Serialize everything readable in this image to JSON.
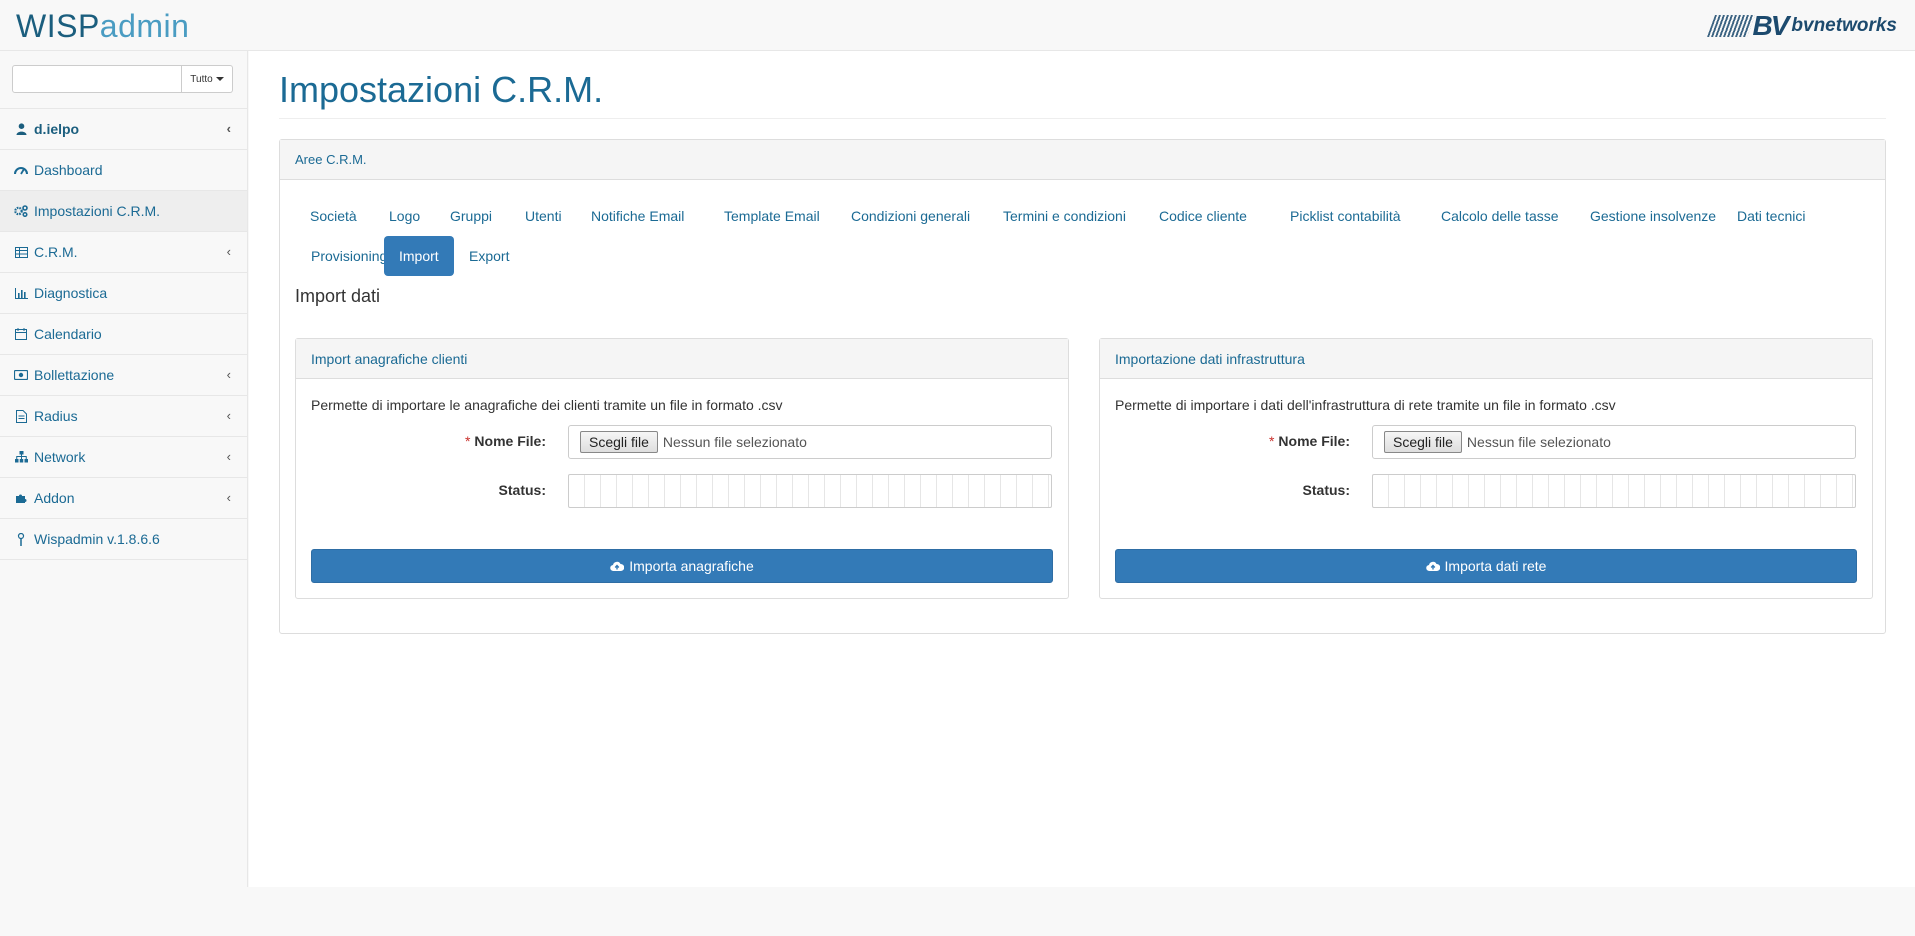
{
  "app": {
    "logo_wisp": "WISP",
    "logo_admin": "admin",
    "brand_name": "bvnetworks",
    "brand_mark": "BV"
  },
  "sidebar": {
    "search": {
      "value": "",
      "placeholder": "",
      "filter_label": "Tutto"
    },
    "user": "d.ielpo",
    "items": [
      {
        "label": "Dashboard",
        "icon": "dashboard-icon",
        "has_submenu": false
      },
      {
        "label": "Impostazioni C.R.M.",
        "icon": "cogs-icon",
        "has_submenu": false,
        "active": true
      },
      {
        "label": "C.R.M.",
        "icon": "table-icon",
        "has_submenu": true
      },
      {
        "label": "Diagnostica",
        "icon": "bar-chart-icon",
        "has_submenu": false
      },
      {
        "label": "Calendario",
        "icon": "calendar-icon",
        "has_submenu": false
      },
      {
        "label": "Bollettazione",
        "icon": "money-icon",
        "has_submenu": true
      },
      {
        "label": "Radius",
        "icon": "document-icon",
        "has_submenu": true
      },
      {
        "label": "Network",
        "icon": "sitemap-icon",
        "has_submenu": true
      },
      {
        "label": "Addon",
        "icon": "puzzle-icon",
        "has_submenu": true
      },
      {
        "label": "Wispadmin v.1.8.6.6",
        "icon": "antenna-icon",
        "has_submenu": false
      }
    ]
  },
  "page": {
    "title": "Impostazioni C.R.M.",
    "panel_title": "Aree C.R.M.",
    "tabs": [
      {
        "label": "Società"
      },
      {
        "label": "Logo"
      },
      {
        "label": "Gruppi"
      },
      {
        "label": "Utenti"
      },
      {
        "label": "Notifiche Email"
      },
      {
        "label": "Template Email"
      },
      {
        "label": "Condizioni generali"
      },
      {
        "label": "Termini e condizioni"
      },
      {
        "label": "Codice cliente"
      },
      {
        "label": "Picklist contabilità"
      },
      {
        "label": "Calcolo delle tasse"
      },
      {
        "label": "Gestione insolvenze"
      },
      {
        "label": "Dati tecnici"
      },
      {
        "label": "Provisioning"
      },
      {
        "label": "Import",
        "active": true
      },
      {
        "label": "Export"
      }
    ],
    "section_title": "Import dati"
  },
  "cards": [
    {
      "title": "Import anagrafiche clienti",
      "description": "Permette di importare le anagrafiche dei clienti tramite un file in formato .csv",
      "required_mark": "*",
      "file_label": "Nome File:",
      "file_button": "Scegli file",
      "file_status": "Nessun file selezionato",
      "status_label": "Status:",
      "action_label": "Importa anagrafiche"
    },
    {
      "title": "Importazione dati infrastruttura",
      "description": "Permette di importare i dati dell'infrastruttura di rete tramite un file in formato .csv",
      "required_mark": "*",
      "file_label": "Nome File:",
      "file_button": "Scegli file",
      "file_status": "Nessun file selezionato",
      "status_label": "Status:",
      "action_label": "Importa dati rete"
    }
  ],
  "colors": {
    "accent": "#337ab7",
    "link": "#1b6a94",
    "required": "#c9302c"
  }
}
